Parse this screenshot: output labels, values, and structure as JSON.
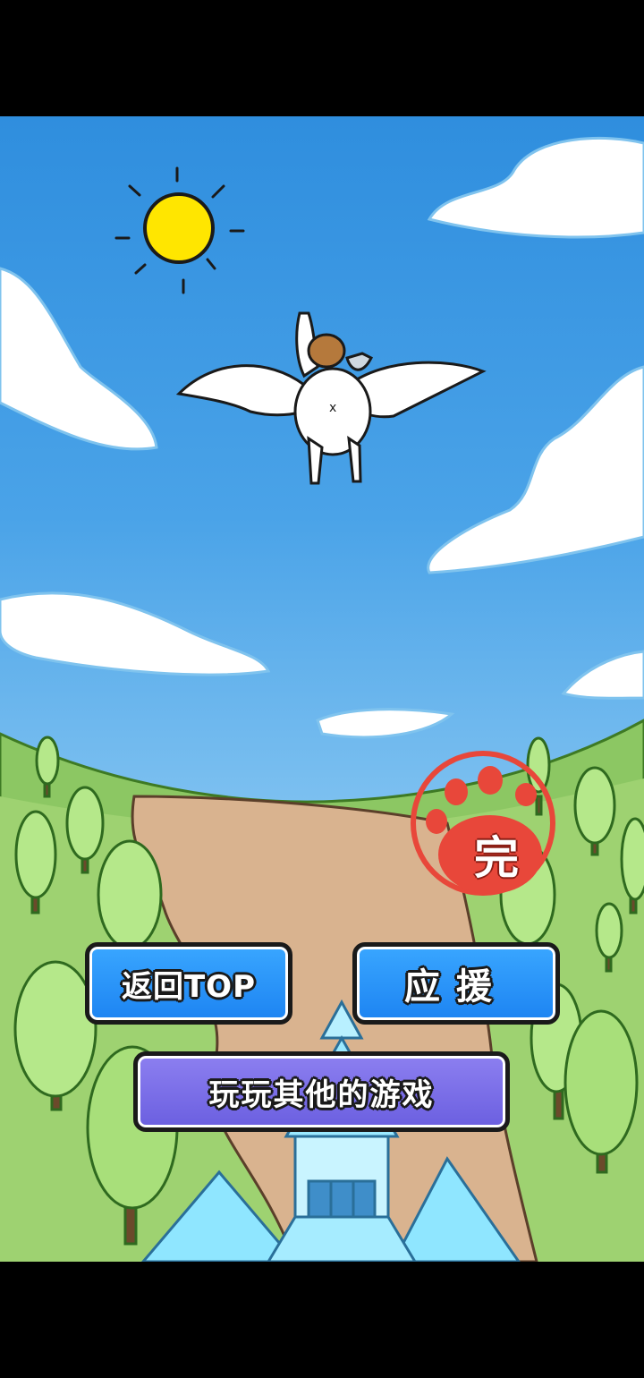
{
  "buttons": {
    "back_top_label": "返回TOP",
    "cheer_label": "应援",
    "more_games_label": "玩玩其他的游戏"
  },
  "stamp": {
    "label": "完"
  },
  "colors": {
    "sky_top": "#2f8ede",
    "grass": "#8cc763",
    "path": "#d9b38f",
    "button_blue": "#2b95ff",
    "button_purple": "#7b6fe8",
    "stamp_red": "#e8473a",
    "sun": "#ffe600"
  },
  "icons": [
    "sun-icon",
    "pegasus-icon",
    "paw-stamp-icon",
    "castle-icon",
    "tree-icon",
    "cloud-icon"
  ]
}
